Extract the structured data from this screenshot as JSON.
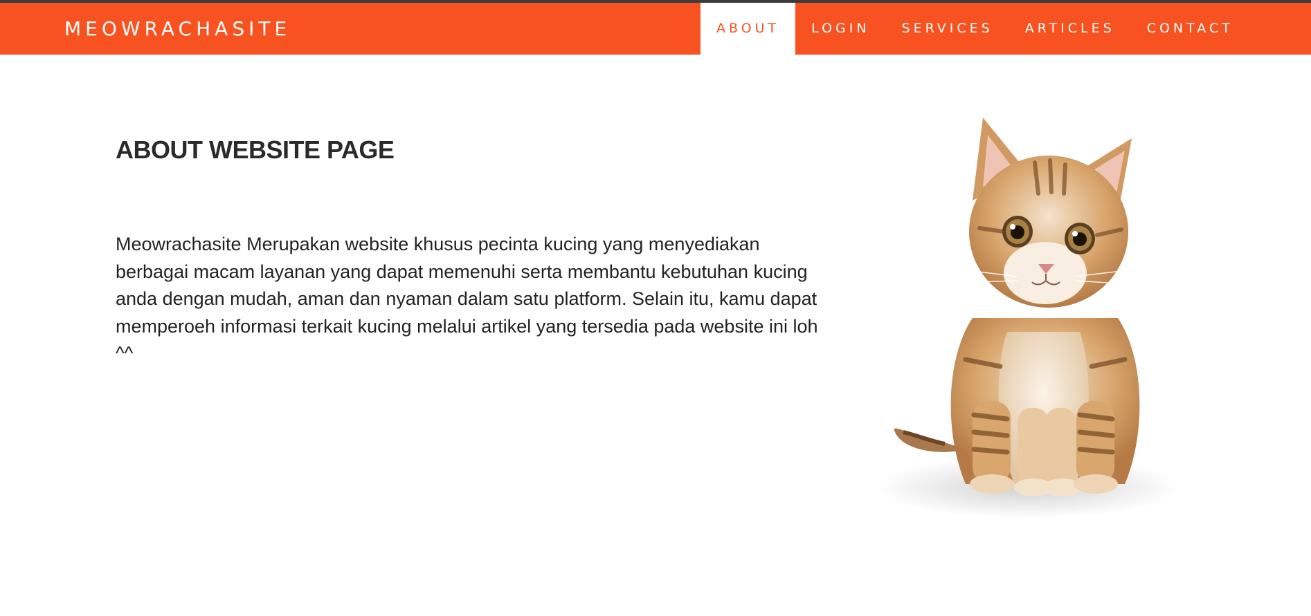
{
  "header": {
    "brand": "MEOWRACHASITE",
    "nav": [
      {
        "label": "ABOUT",
        "active": true
      },
      {
        "label": "LOGIN",
        "active": false
      },
      {
        "label": "SERVICES",
        "active": false
      },
      {
        "label": "ARTICLES",
        "active": false
      },
      {
        "label": "CONTACT",
        "active": false
      }
    ]
  },
  "main": {
    "title": "ABOUT WEBSITE PAGE",
    "paragraph": "Meowrachasite Merupakan website khusus pecinta kucing yang menyediakan berbagai macam layanan yang dapat memenuhi serta membantu kebutuhan kucing anda dengan mudah, aman dan nyaman dalam satu platform. Selain itu, kamu dapat memperoeh informasi terkait kucing melalui artikel yang tersedia pada website ini loh ^^"
  },
  "image": {
    "subject": "kitten-photo"
  },
  "colors": {
    "accent": "#f75220",
    "topline": "#3b3b3b",
    "text": "#222222"
  }
}
